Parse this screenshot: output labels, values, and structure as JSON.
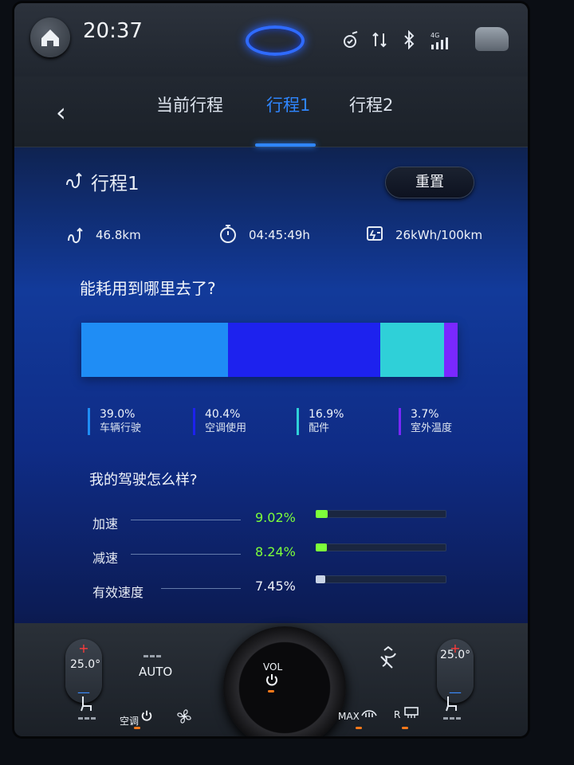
{
  "status": {
    "time": "20:37"
  },
  "tabs": [
    {
      "label": "当前行程"
    },
    {
      "label": "行程1"
    },
    {
      "label": "行程2"
    }
  ],
  "trip": {
    "title": "行程1",
    "reset_label": "重置",
    "distance": "46.8km",
    "duration": "04:45:49h",
    "consumption": "26kWh/100km"
  },
  "energy": {
    "question": "能耗用到哪里去了?",
    "segments": [
      {
        "pct_label": "39.0%",
        "name": "车辆行驶",
        "value": 39.0,
        "color": "#1f8df5"
      },
      {
        "pct_label": "40.4%",
        "name": "空调使用",
        "value": 40.4,
        "color": "#1d22ee"
      },
      {
        "pct_label": "16.9%",
        "name": "配件",
        "value": 16.9,
        "color": "#2fd0d8"
      },
      {
        "pct_label": "3.7%",
        "name": "室外温度",
        "value": 3.7,
        "color": "#7a28ff"
      }
    ]
  },
  "driving": {
    "question": "我的驾驶怎么样?",
    "rows": [
      {
        "label": "加速",
        "value_label": "9.02%",
        "value": 9.02,
        "color": "#7dff3a"
      },
      {
        "label": "减速",
        "value_label": "8.24%",
        "value": 8.24,
        "color": "#7dff3a"
      },
      {
        "label": "有效速度",
        "value_label": "7.45%",
        "value": 7.45,
        "color": "#c9d4e6"
      }
    ]
  },
  "climate": {
    "left_temp": "25.0°",
    "right_temp": "25.0°",
    "auto_label": "AUTO",
    "vol_label": "VOL",
    "ac_label": "空调",
    "max_label": "MAX",
    "rear_label": "R"
  }
}
